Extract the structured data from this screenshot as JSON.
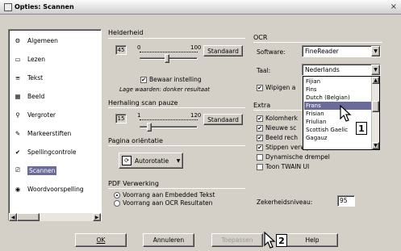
{
  "window": {
    "title": "Opties: Scannen",
    "close_glyph": "×"
  },
  "sidebar": {
    "items": [
      {
        "label": "Algemeen",
        "icon": "settings-icon",
        "glyph": "⚙"
      },
      {
        "label": "Lezen",
        "icon": "scanner-icon",
        "glyph": "▭"
      },
      {
        "label": "Tekst",
        "icon": "text-icon",
        "glyph": "≡"
      },
      {
        "label": "Beeld",
        "icon": "image-icon",
        "glyph": "▦"
      },
      {
        "label": "Vergroter",
        "icon": "magnifier-icon",
        "glyph": "⚲"
      },
      {
        "label": "Markeerstiften",
        "icon": "marker-icon",
        "glyph": "✎"
      },
      {
        "label": "Spellingcontrole",
        "icon": "spellcheck-icon",
        "glyph": "✔"
      },
      {
        "label": "Scannen",
        "icon": "scan-icon",
        "glyph": "⎚"
      },
      {
        "label": "Woordvoorspelling",
        "icon": "prediction-icon",
        "glyph": "◉"
      }
    ],
    "selected": "Scannen",
    "scroll_left": "◀",
    "scroll_right": "▶"
  },
  "helderheid": {
    "title": "Helderheid",
    "value": "45",
    "min": "0",
    "max": "100",
    "button": "Standaard",
    "checkbox_label": "Bewaar instelling",
    "checkbox_checked": "✔",
    "note": "Lage waarden: donker resultaat",
    "level": 0.45
  },
  "herhaling": {
    "title": "Herhaling scan pauze",
    "value": "15",
    "min": "1",
    "max": "120",
    "button": "Standaard",
    "level": 0.12
  },
  "orientatie": {
    "title": "Pagina oriëntatie",
    "value": "Autorotatie",
    "arrow": "▼"
  },
  "pdf": {
    "title": "PDF Verwerking",
    "options": [
      "Voorrang aan Embedded Tekst",
      "Voorrang aan OCR Resultaten"
    ],
    "selected_index": 0
  },
  "ocr": {
    "title": "OCR",
    "software_label": "Software:",
    "software_value": "FineReader",
    "taal_label": "Taal:",
    "taal_value": "Nederlands",
    "wipigen_label": "Wipigen a",
    "arrow": "▼"
  },
  "dropdown": {
    "options": [
      "Fijian",
      "Fins",
      "Dutch (Belgian)",
      "Frans",
      "Frisian",
      "Friulian",
      "Scottish Gaelic",
      "Gagauz"
    ],
    "highlighted": "Frans",
    "scroll_up": "▲",
    "scroll_down": "▼"
  },
  "extra": {
    "title": "Extra",
    "options": [
      {
        "label": "Kolomherk",
        "checked": "✔"
      },
      {
        "label": "Nieuwe sc",
        "checked": "✔"
      },
      {
        "label": "Beeld rech",
        "checked": "✔"
      },
      {
        "label": "Stippen verwijderen",
        "checked": "✔"
      },
      {
        "label": "Dynamische drempel",
        "checked": ""
      },
      {
        "label": "Toon TWAIN UI",
        "checked": ""
      }
    ],
    "zekerheid_label": "Zekerheidsniveau:",
    "zekerheid_value": "95"
  },
  "callouts": {
    "one": "1",
    "two": "2"
  },
  "footer": {
    "ok": "OK",
    "annuleren": "Annuleren",
    "toepassen": "Toepassen",
    "help": "Help"
  }
}
